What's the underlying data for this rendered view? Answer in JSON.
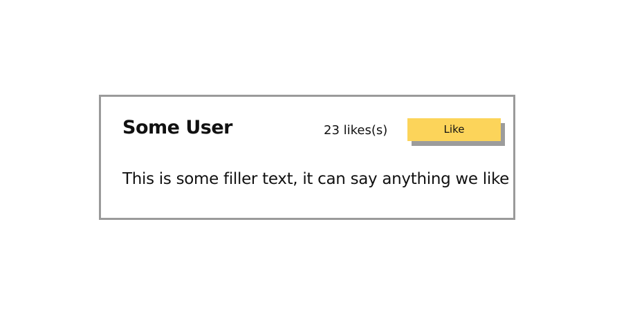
{
  "post_card": {
    "username": "Some User",
    "likes_count_text": "23 likes(s)",
    "like_button_label": "Like",
    "body_text": "This is some filler text, it can say anything we like"
  },
  "colors": {
    "card_border": "#9a9a9a",
    "like_button_background": "#fcd45a",
    "like_button_shadow": "#9c9c9c",
    "text": "#111111",
    "page_background": "#ffffff"
  }
}
